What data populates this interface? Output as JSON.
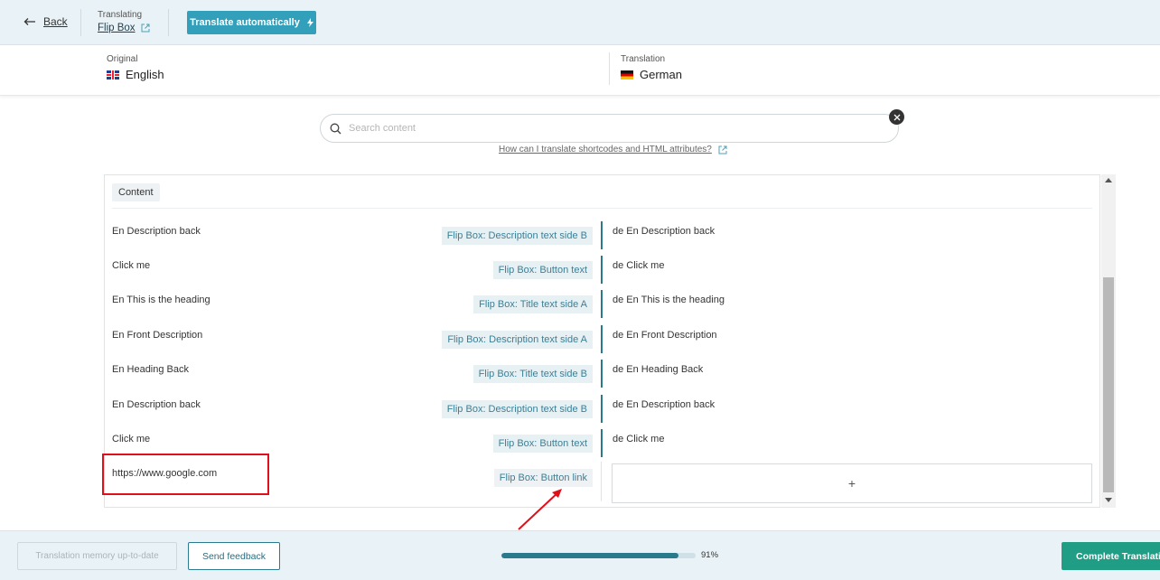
{
  "header": {
    "back_label": "Back",
    "translating_label": "Translating",
    "item_title": "Flip Box",
    "auto_translate_label": "Translate automatically"
  },
  "languages": {
    "original_label": "Original",
    "original_name": "English",
    "translation_label": "Translation",
    "translation_name": "German"
  },
  "search": {
    "placeholder": "Search content",
    "help_link": "How can I translate shortcodes and HTML attributes?"
  },
  "section": {
    "title": "Content"
  },
  "rows": [
    {
      "source": "En Description back",
      "field": "Flip Box: Description text side B",
      "target": "de En Description back"
    },
    {
      "source": "Click me",
      "field": "Flip Box: Button text",
      "target": "de Click me"
    },
    {
      "source": "En This is the heading",
      "field": "Flip Box: Title text side A",
      "target": "de En This is the heading"
    },
    {
      "source": "En Front Description",
      "field": "Flip Box: Description text side A",
      "target": "de En Front Description"
    },
    {
      "source": "En Heading Back",
      "field": "Flip Box: Title text side B",
      "target": "de En Heading Back"
    },
    {
      "source": "En Description back",
      "field": "Flip Box: Description text side B",
      "target": "de En Description back"
    },
    {
      "source": "Click me",
      "field": "Flip Box: Button text",
      "target": "de Click me"
    },
    {
      "source": "https://www.google.com",
      "field": "Flip Box: Button link",
      "target": ""
    }
  ],
  "add_symbol": "+",
  "footer": {
    "memory_label": "Translation memory up-to-date",
    "feedback_label": "Send feedback",
    "progress_percent": 91,
    "progress_text": "91%",
    "complete_label": "Complete Translation"
  },
  "colors": {
    "accent": "#33a0bb",
    "complete": "#1f9e85",
    "highlight": "#e0101a"
  },
  "icons": [
    "arrow-left-icon",
    "external-link-icon",
    "bolt-icon",
    "search-icon",
    "close-icon",
    "plus-icon"
  ]
}
